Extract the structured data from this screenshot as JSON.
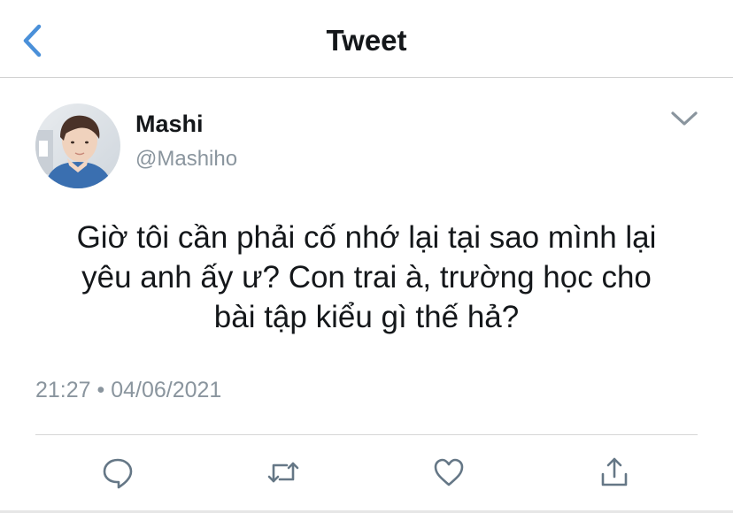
{
  "header": {
    "title": "Tweet",
    "back_icon": "chevron-left-icon",
    "accent_color": "#4a90d9"
  },
  "tweet": {
    "author": {
      "display_name": "Mashi",
      "handle": "@Mashiho",
      "avatar": "user-avatar"
    },
    "menu_icon": "chevron-down-icon",
    "text_lines": [
      "Giờ tôi cần phải cố nhớ lại tại sao mình lại",
      "yêu anh ấy ư? Con trai à, trường học cho",
      "bài tập kiểu gì thế hả?"
    ],
    "timestamp": "21:27 • 04/06/2021"
  },
  "actions": [
    {
      "name": "reply",
      "icon": "comment-icon"
    },
    {
      "name": "retweet",
      "icon": "retweet-icon"
    },
    {
      "name": "like",
      "icon": "heart-icon"
    },
    {
      "name": "share",
      "icon": "share-icon"
    }
  ],
  "colors": {
    "text": "#14171a",
    "secondary_text": "#8a959e",
    "icon_gray": "#657786",
    "divider": "#d6d6d6"
  }
}
